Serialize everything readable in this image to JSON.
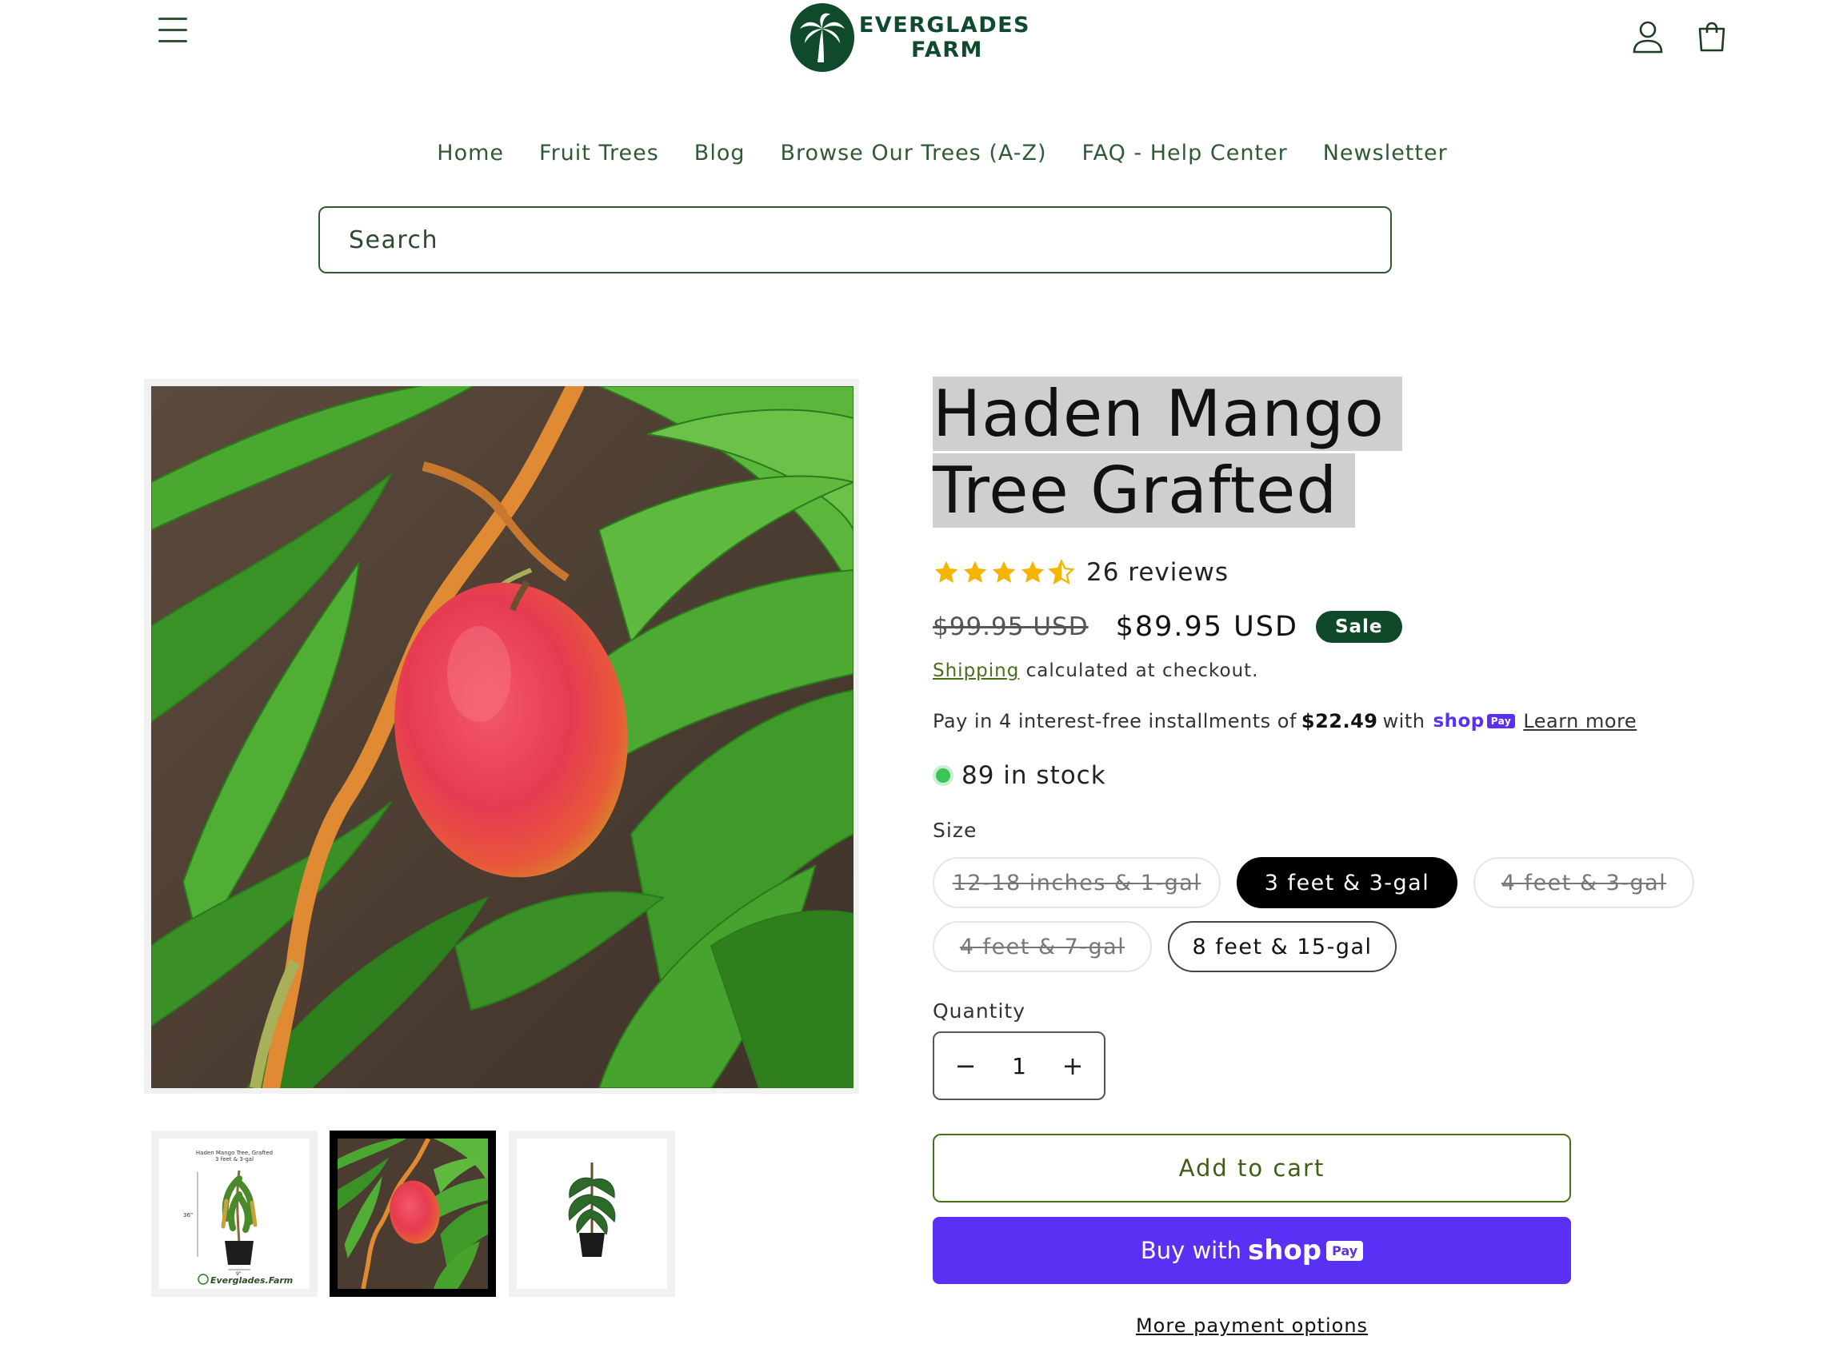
{
  "header": {
    "logo_line1": "EVERGLADES",
    "logo_line2": "FARM",
    "menu_icon": "hamburger-icon",
    "account_icon": "user-icon",
    "cart_icon": "cart-icon"
  },
  "nav": {
    "items": [
      "Home",
      "Fruit Trees",
      "Blog",
      "Browse Our Trees (A-Z)",
      "FAQ - Help Center",
      "Newsletter"
    ]
  },
  "search": {
    "placeholder": "Search"
  },
  "product": {
    "title": "Haden Mango Tree Grafted",
    "rating": {
      "value": 4.5,
      "max": 5,
      "reviews_label": "26 reviews"
    },
    "price_old": "$99.95 USD",
    "price_new": "$89.95 USD",
    "sale_badge": "Sale",
    "shipping_link": "Shipping",
    "shipping_rest": "calculated at checkout.",
    "installments": {
      "prefix": "Pay in 4 interest-free installments of",
      "amount": "$22.49",
      "suffix": "with",
      "brand": "shop",
      "brand_badge": "Pay",
      "learn_more": "Learn more"
    },
    "stock": "89 in stock",
    "size_label": "Size",
    "sizes": [
      {
        "label": "12-18 inches & 1-gal",
        "state": "unavailable"
      },
      {
        "label": "3 feet & 3-gal",
        "state": "selected"
      },
      {
        "label": "4 feet & 3-gal",
        "state": "unavailable"
      },
      {
        "label": "4 feet & 7-gal",
        "state": "unavailable"
      },
      {
        "label": "8 feet & 15-gal",
        "state": "available"
      }
    ],
    "quantity_label": "Quantity",
    "quantity_value": "1",
    "add_to_cart": "Add to cart",
    "buy_with": "Buy with",
    "buy_brand": "shop",
    "buy_badge": "Pay",
    "more_payment": "More payment options"
  },
  "gallery": {
    "thumb1_caption_line1": "Haden Mango Tree, Grafted",
    "thumb1_caption_line2": "3 feet & 3-gal",
    "thumb1_height": "36\"",
    "thumb1_width": "9\"",
    "thumb1_brand": "Everglades.Farm",
    "active_index": 1
  },
  "colors": {
    "brand_green": "#0f4a2c",
    "nav_green": "#2f5a34",
    "shop_purple": "#5a31f4",
    "stock_green": "#3ac45a"
  }
}
